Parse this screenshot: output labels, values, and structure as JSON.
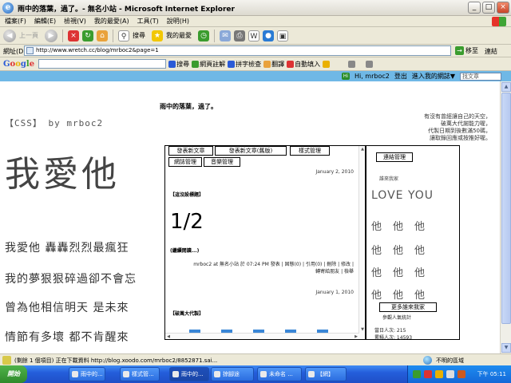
{
  "window": {
    "title": "雨中的落葉，過了。- 無名小站 - Microsoft Internet Explorer",
    "controls": {
      "minimize": "_",
      "maximize": "□",
      "close": "×"
    }
  },
  "menu": [
    "檔案(F)",
    "編輯(E)",
    "檢視(V)",
    "我的最愛(A)",
    "工具(T)",
    "說明(H)"
  ],
  "nav": {
    "back": "上一頁",
    "search": "搜尋",
    "favorites": "我的最愛"
  },
  "address": {
    "label": "網址(D)",
    "url": "http://www.wretch.cc/blog/mrboc2&page=1",
    "go": "移至",
    "links": "連結"
  },
  "google": {
    "logo": "Google",
    "search": "搜尋",
    "translate_page": "網頁註解",
    "spell": "拼字檢查",
    "translate": "翻譯",
    "autofill": "自動填入"
  },
  "blog_header": {
    "greeting": "Hi, mrboc2",
    "logout": "登出",
    "my_blog": "進入我的網誌▼",
    "search_placeholder": "找文章"
  },
  "page": {
    "blog_title": "雨中的落葉，過了。",
    "css_label": "【CSS】 by mrboc2",
    "big_title": "我愛他",
    "poem": [
      "我愛他  轟轟烈烈最瘋狂",
      "我的夢狠狠碎過卻不會忘",
      "曾為他相信明天   是未來",
      "情節有多壞  都不肯醒來"
    ],
    "intro": [
      "有沒有曾經讓自己的天空，",
      "破萬大代謝能力喔，",
      "代製日期到後數滿50碼，",
      "讓取錄回應或按推好喔。"
    ],
    "tabs": [
      "發表新文章",
      "發表新文章(舊版)",
      "樣式管理",
      "網誌管理",
      "音樂管理"
    ],
    "post1": {
      "date": "January 2, 2010",
      "title": "【這沒設標題】",
      "number": "1/2",
      "read_more": "(繼續閱讀...)",
      "meta": [
        "mrboc2 at 無名小站 於 07:24 PM 發表 | 固態(0) | 引用(0) | 刪除 | 修改 |",
        "轉寄給朋友 | 檢舉"
      ]
    },
    "post2": {
      "date": "January 1, 2010",
      "title": "【破萬大代製】"
    },
    "side": {
      "link_manage": "連結管理",
      "caption": "誰來我家",
      "love": "LOVE  YOU",
      "tags": [
        "他他他",
        "他他他",
        "他他他",
        "他他他"
      ],
      "more_visitors": "更多誰來我家",
      "counter": "參觀人氣統計",
      "today": "當日人次: 215",
      "total": "累積人次: 14593"
    }
  },
  "status": {
    "message": "(剩餘 1 個項目) 正在下載資料 http://blog.xoodo.com/mrboc2/8852871.sai...",
    "zone": "不明的區域"
  },
  "taskbar": {
    "start": "開始",
    "buttons": [
      "雨中的...",
      "樣式管...",
      "雨中的...",
      "掠腳途",
      "未命名 ...",
      "【網】"
    ],
    "clock": "下午 05:11"
  }
}
